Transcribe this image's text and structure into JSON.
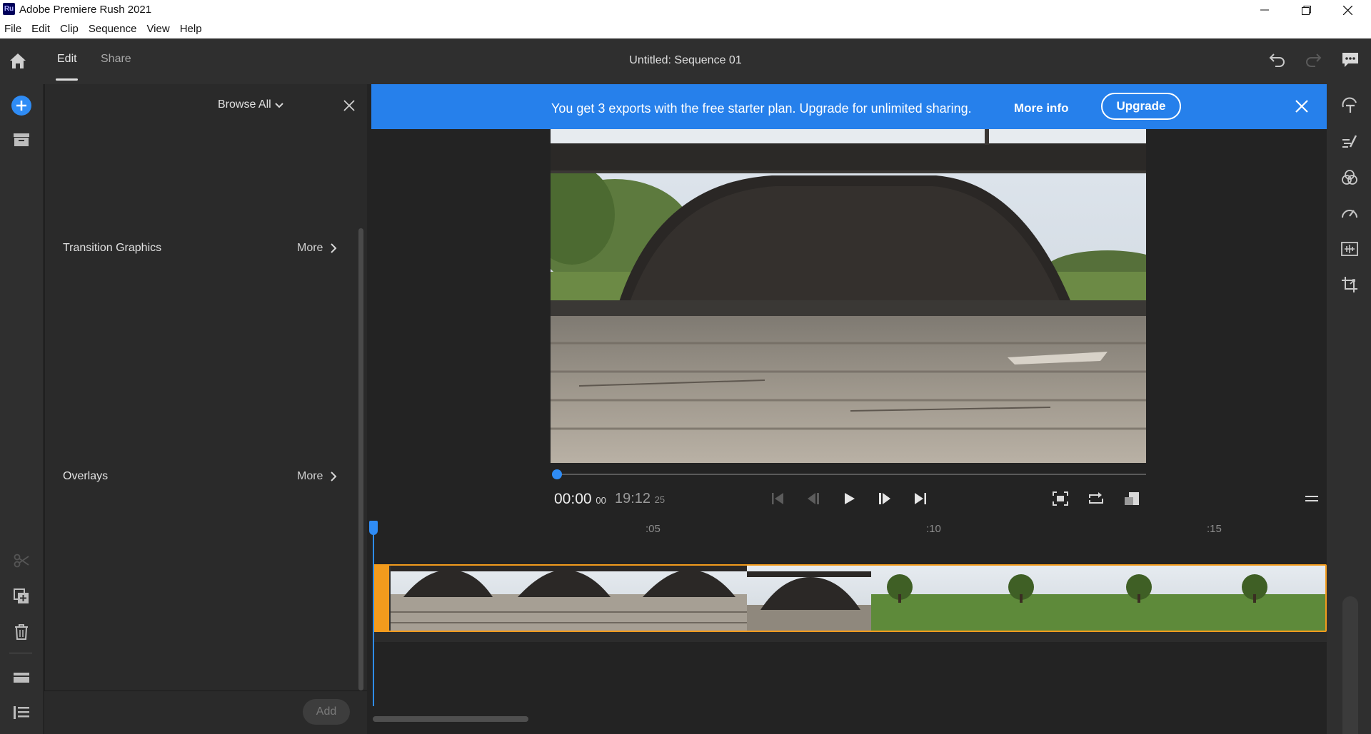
{
  "window": {
    "title": "Adobe Premiere Rush 2021",
    "app_icon_text": "Ru"
  },
  "menu": [
    "File",
    "Edit",
    "Clip",
    "Sequence",
    "View",
    "Help"
  ],
  "header": {
    "tabs": {
      "edit": "Edit",
      "share": "Share"
    },
    "sequence_title": "Untitled: Sequence 01"
  },
  "panel": {
    "browse_label": "Browse All",
    "sections": [
      {
        "title": "Transition Graphics",
        "more": "More"
      },
      {
        "title": "Overlays",
        "more": "More"
      }
    ],
    "add_label": "Add"
  },
  "banner": {
    "text": "You get 3 exports with the free starter plan. Upgrade for unlimited sharing.",
    "more_info": "More info",
    "upgrade": "Upgrade"
  },
  "player": {
    "current_time": "00:00",
    "current_frame": "00",
    "total_time": "19:12",
    "total_frame": "25",
    "progress": 0
  },
  "timeline": {
    "ruler_labels": [
      ":05",
      ":10",
      ":15"
    ]
  },
  "colors": {
    "accent_blue": "#2680eb",
    "clip_orange": "#f29b1d",
    "playhead_blue": "#2f8cf5"
  }
}
